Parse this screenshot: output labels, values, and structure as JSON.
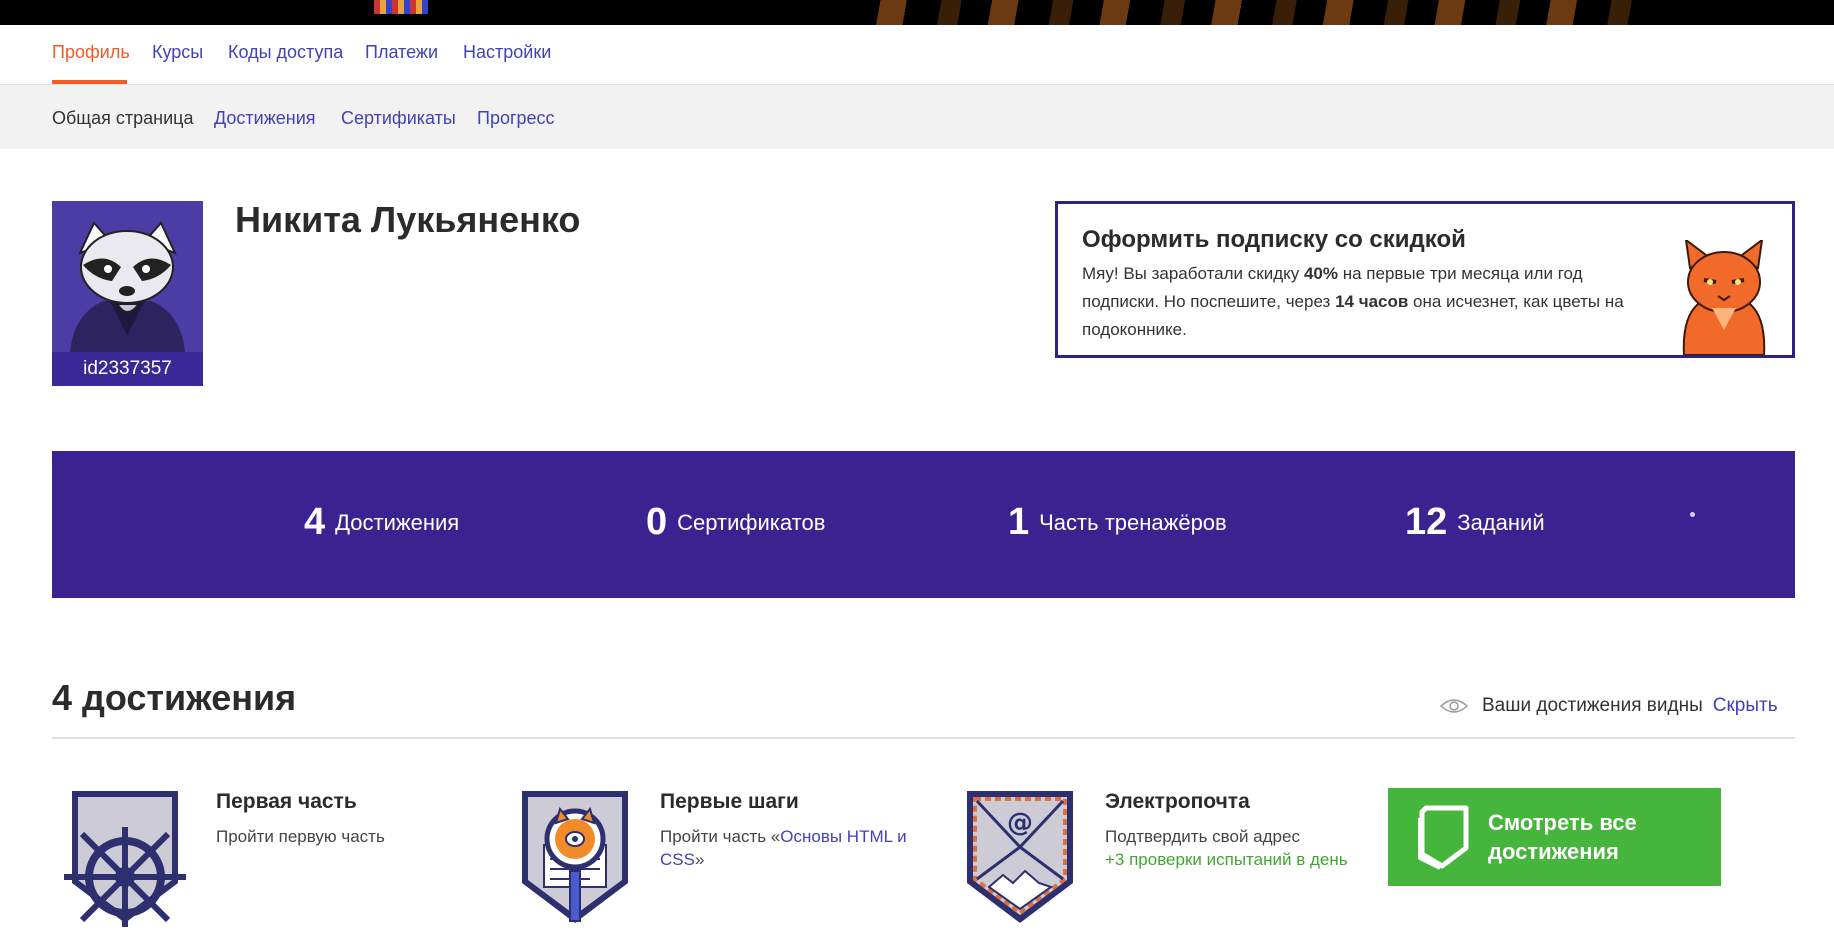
{
  "main_nav": {
    "profile": "Профиль",
    "courses": "Курсы",
    "access_codes": "Коды доступа",
    "payments": "Платежи",
    "settings": "Настройки"
  },
  "sub_nav": {
    "overview": "Общая страница",
    "achievements": "Достижения",
    "certificates": "Сертификаты",
    "progress": "Прогресс"
  },
  "profile": {
    "name": "Никита Лукьяненко",
    "user_id": "id2337357"
  },
  "promo": {
    "title": "Оформить подписку со скидкой",
    "text_1": "Мяу! Вы заработали скидку ",
    "discount": "40%",
    "text_2": " на первые три месяца или год подписки. Но поспешите, через ",
    "hours": "14 часов",
    "text_3": " она исчезнет, как цветы на подоконнике."
  },
  "stats": [
    {
      "value": "4",
      "label": "Достижения"
    },
    {
      "value": "0",
      "label": "Сертификатов"
    },
    {
      "value": "1",
      "label": "Часть тренажёров"
    },
    {
      "value": "12",
      "label": "Заданий"
    }
  ],
  "achievements": {
    "title": "4 достижения",
    "visibility_text": "Ваши достижения видны",
    "hide_label": "Скрыть",
    "items": [
      {
        "name": "Первая часть",
        "desc": "Пройти первую часть"
      },
      {
        "name": "Первые шаги",
        "desc_prefix": "Пройти часть «",
        "desc_link": "Основы HTML и CSS",
        "desc_suffix": "»"
      },
      {
        "name": "Электропочта",
        "desc": "Подтвердить свой адрес",
        "bonus": "+3 проверки испытаний в день"
      }
    ],
    "view_all_label": "Смотреть все достижения"
  },
  "colors": {
    "accent": "#f25a26",
    "link": "#4242b8",
    "stats_bg": "#3a2390",
    "view_all_bg": "#46b53c"
  }
}
